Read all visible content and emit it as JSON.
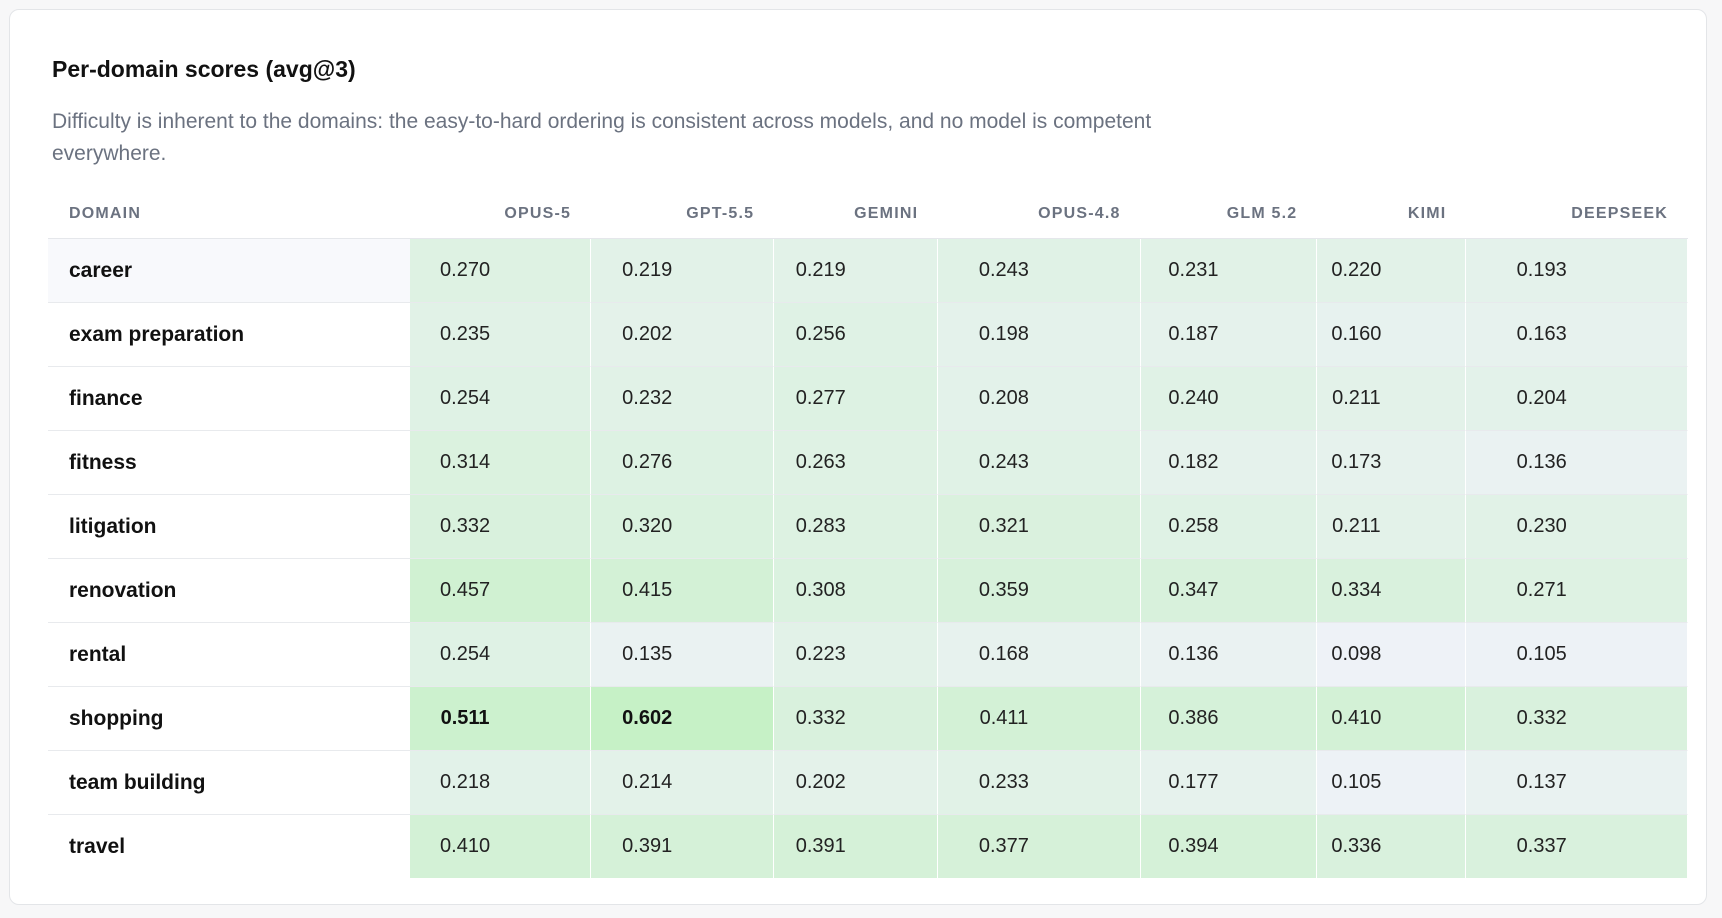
{
  "title": "Per-domain scores (avg@3)",
  "subtitle": "Difficulty is inherent to the domains: the easy-to-hard ordering is consistent across models, and no model is competent everywhere.",
  "colors": {
    "low": "#eef2f7",
    "high": "#c6f1c6"
  },
  "chart_data": {
    "type": "heatmap",
    "title": "Per-domain scores (avg@3)",
    "row_header": "DOMAIN",
    "columns": [
      "OPUS-5",
      "GPT-5.5",
      "GEMINI",
      "OPUS-4.8",
      "GLM 5.2",
      "KIMI",
      "DEEPSEEK"
    ],
    "rows": [
      {
        "domain": "career",
        "values": [
          "0.270",
          "0.219",
          "0.219",
          "0.243",
          "0.231",
          "0.220",
          "0.193"
        ]
      },
      {
        "domain": "exam preparation",
        "values": [
          "0.235",
          "0.202",
          "0.256",
          "0.198",
          "0.187",
          "0.160",
          "0.163"
        ]
      },
      {
        "domain": "finance",
        "values": [
          "0.254",
          "0.232",
          "0.277",
          "0.208",
          "0.240",
          "0.211",
          "0.204"
        ]
      },
      {
        "domain": "fitness",
        "values": [
          "0.314",
          "0.276",
          "0.263",
          "0.243",
          "0.182",
          "0.173",
          "0.136"
        ]
      },
      {
        "domain": "litigation",
        "values": [
          "0.332",
          "0.320",
          "0.283",
          "0.321",
          "0.258",
          "0.211",
          "0.230"
        ]
      },
      {
        "domain": "renovation",
        "values": [
          "0.457",
          "0.415",
          "0.308",
          "0.359",
          "0.347",
          "0.334",
          "0.271"
        ]
      },
      {
        "domain": "rental",
        "values": [
          "0.254",
          "0.135",
          "0.223",
          "0.168",
          "0.136",
          "0.098",
          "0.105"
        ]
      },
      {
        "domain": "shopping",
        "values": [
          "0.511",
          "0.602",
          "0.332",
          "0.411",
          "0.386",
          "0.410",
          "0.332"
        ]
      },
      {
        "domain": "team building",
        "values": [
          "0.218",
          "0.214",
          "0.202",
          "0.233",
          "0.177",
          "0.105",
          "0.137"
        ]
      },
      {
        "domain": "travel",
        "values": [
          "0.410",
          "0.391",
          "0.391",
          "0.377",
          "0.394",
          "0.336",
          "0.337"
        ]
      }
    ],
    "bold_cells": [
      [
        7,
        0
      ],
      [
        7,
        1
      ]
    ]
  }
}
